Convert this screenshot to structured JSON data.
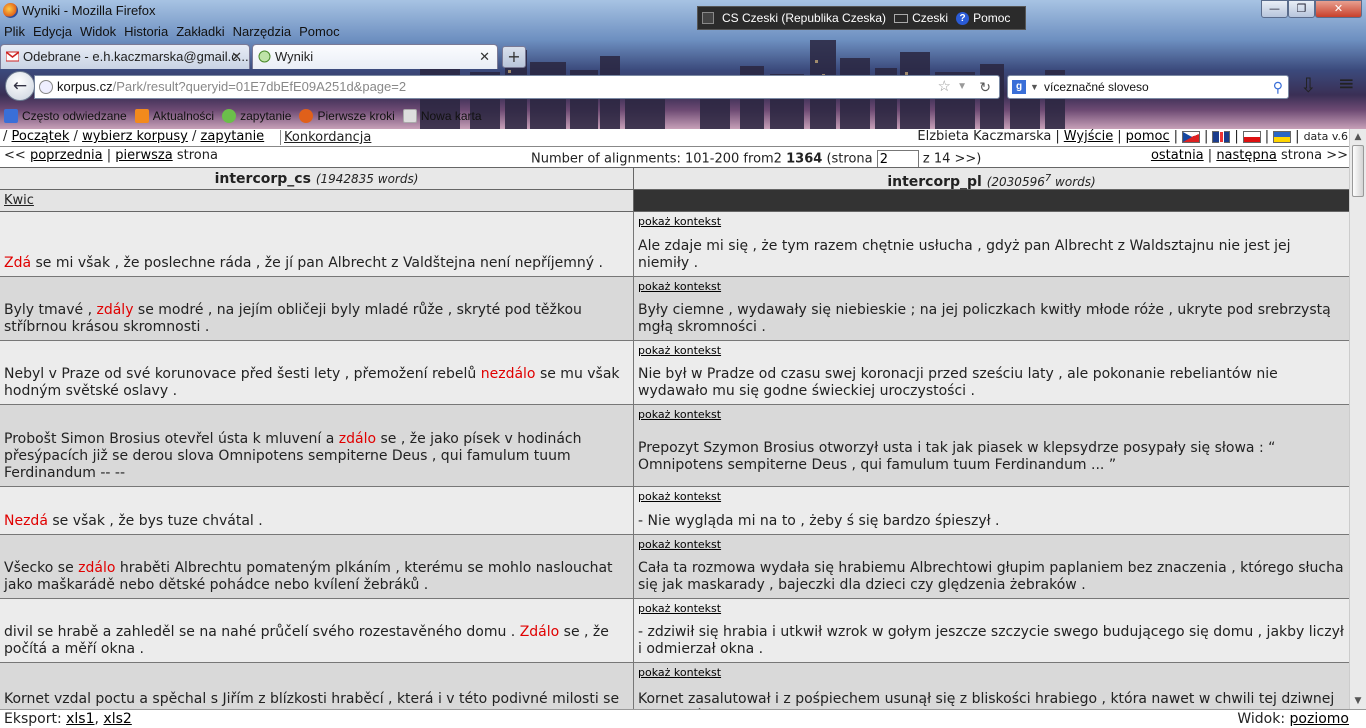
{
  "window": {
    "title": "Wyniki - Mozilla Firefox",
    "min": "—",
    "max": "❐",
    "close": "✕"
  },
  "langbar": {
    "lang": "CS Czeski (Republika Czeska)",
    "kb": "Czeski",
    "help": "Pomoc"
  },
  "menu": [
    "Plik",
    "Edycja",
    "Widok",
    "Historia",
    "Zakładki",
    "Narzędzia",
    "Pomoc"
  ],
  "tabs": [
    {
      "label": "Odebrane - e.h.kaczmarska@gmail.c...",
      "close": "✕"
    },
    {
      "label": "Wyniki",
      "close": "✕"
    }
  ],
  "newtab": "+",
  "url": {
    "host": "korpus.cz",
    "path": "/Park/result?queryid=01E7dbEfE09A251d&page=2"
  },
  "search": {
    "value": "víceznačné sloveso"
  },
  "bookmarks": [
    "Często odwiedzane",
    "Aktualności",
    "zapytanie",
    "Pierwsze kroki",
    "Nowa karta"
  ],
  "app": {
    "nav": {
      "start": "Początek",
      "corpora": "wybierz korpusy",
      "query": "zapytanie",
      "konkordancja": "Konkordancja"
    },
    "user": "Elzbieta Kaczmarska",
    "logout": "Wyjście",
    "help": "pomoc",
    "version": "data v.6",
    "pager": {
      "prev": "poprzednia",
      "first": "pierwsza",
      "strona": "strona",
      "prev_prefix": "<<",
      "count_text": "Number of alignments: 101-200 from2",
      "total": "1364",
      "page_prefix": "(strona",
      "page": "2",
      "page_suffix": "z 14 >>)",
      "last": "ostatnia",
      "next": "następna",
      "next_suffix": "strona >>"
    },
    "columns": {
      "left": {
        "name": "intercorp_cs",
        "words": "(1942835 words)"
      },
      "right": {
        "name": "intercorp_pl",
        "words": "(2030596",
        "sup": "7",
        "words_end": " words)"
      }
    },
    "kwic": "Kwic",
    "context_label": "pokaż kontekst",
    "rows": [
      {
        "cs_pre": "",
        "cs_kw": "Zdá",
        "cs_post": " se mi však , že poslechne ráda , že jí pan Albrecht z Valdštejna není nepříjemný .",
        "pl": "Ale zdaje mi się , że tym razem chętnie usłucha , gdyż pan Albrecht z Waldsztajnu nie jest jej niemiły ."
      },
      {
        "cs_pre": "Byly tmavé , ",
        "cs_kw": "zdály",
        "cs_post": " se modré , na jejím obličeji byly mladé růže , skryté pod těžkou stříbrnou krásou skromnosti .",
        "pl": "Były ciemne , wydawały się niebieskie ; na jej policzkach kwitły młode róże , ukryte pod srebrzystą mgłą skromności ."
      },
      {
        "cs_pre": "Nebyl v Praze od své korunovace před šesti lety , přemožení rebelů ",
        "cs_kw": "nezdálo",
        "cs_post": " se mu však hodným světské oslavy .",
        "pl": "Nie był w Pradze od czasu swej koronacji przed sześciu laty , ale pokonanie rebeliantów nie wydawało mu się godne świeckiej uroczystości ."
      },
      {
        "cs_pre": "Probošt Simon Brosius otevřel ústa k mluvení a ",
        "cs_kw": "zdálo",
        "cs_post": " se , že jako písek v hodinách přesýpacích již se derou slova Omnipotens sempiterne Deus , qui famulum tuum Ferdinandum -- --",
        "pl": "Prepozyt Szymon Brosius otworzył usta i tak jak piasek w klepsydrze posypały się słowa : “ Omnipotens sempiterne Deus , qui famulum tuum Ferdinandum ... ”"
      },
      {
        "cs_pre": "",
        "cs_kw": "Nezdá",
        "cs_post": " se však , že bys tuze chvátal .",
        "pl": "- Nie wygląda mi na to , żeby ś się bardzo śpieszył ."
      },
      {
        "cs_pre": "Všecko se ",
        "cs_kw": "zdálo",
        "cs_post": " hraběti Albrechtu pomateným plkáním , kterému se mohlo naslouchat jako maškarádě nebo dětské pohádce nebo kvílení žebráků .",
        "pl": "Cała ta rozmowa wydała się hrabiemu Albrechtowi głupim paplaniem bez znaczenia , którego słucha się jak maskarady , bajeczki dla dzieci czy ględzenia żebraków ."
      },
      {
        "cs_pre": "divil se hrabě a zahleděl se na nahé průčelí svého rozestavěného domu . ",
        "cs_kw": "Zdálo",
        "cs_post": " se , že počítá a měří okna .",
        "pl": "- zdziwił się hrabia i utkwił wzrok w gołym jeszcze szczycie swego budującego się domu , jakby liczył i odmierzał okna ."
      },
      {
        "cs_pre": "Kornet vzdal poctu a spěchal s Jiřím z blízkosti hraběcí , která i v této podivné milosti se",
        "cs_kw": "",
        "cs_post": "",
        "pl": "Kornet zasalutował i z pośpiechem usunął się z bliskości hrabiego , która nawet w chwili tej dziwnej łaskawości wydawała się niebezpieczna ."
      }
    ],
    "footer": {
      "export": "Eksport:",
      "xls1": "xls1",
      "xls2": "xls2",
      "view": "Widok:",
      "mode": "poziomo"
    }
  }
}
